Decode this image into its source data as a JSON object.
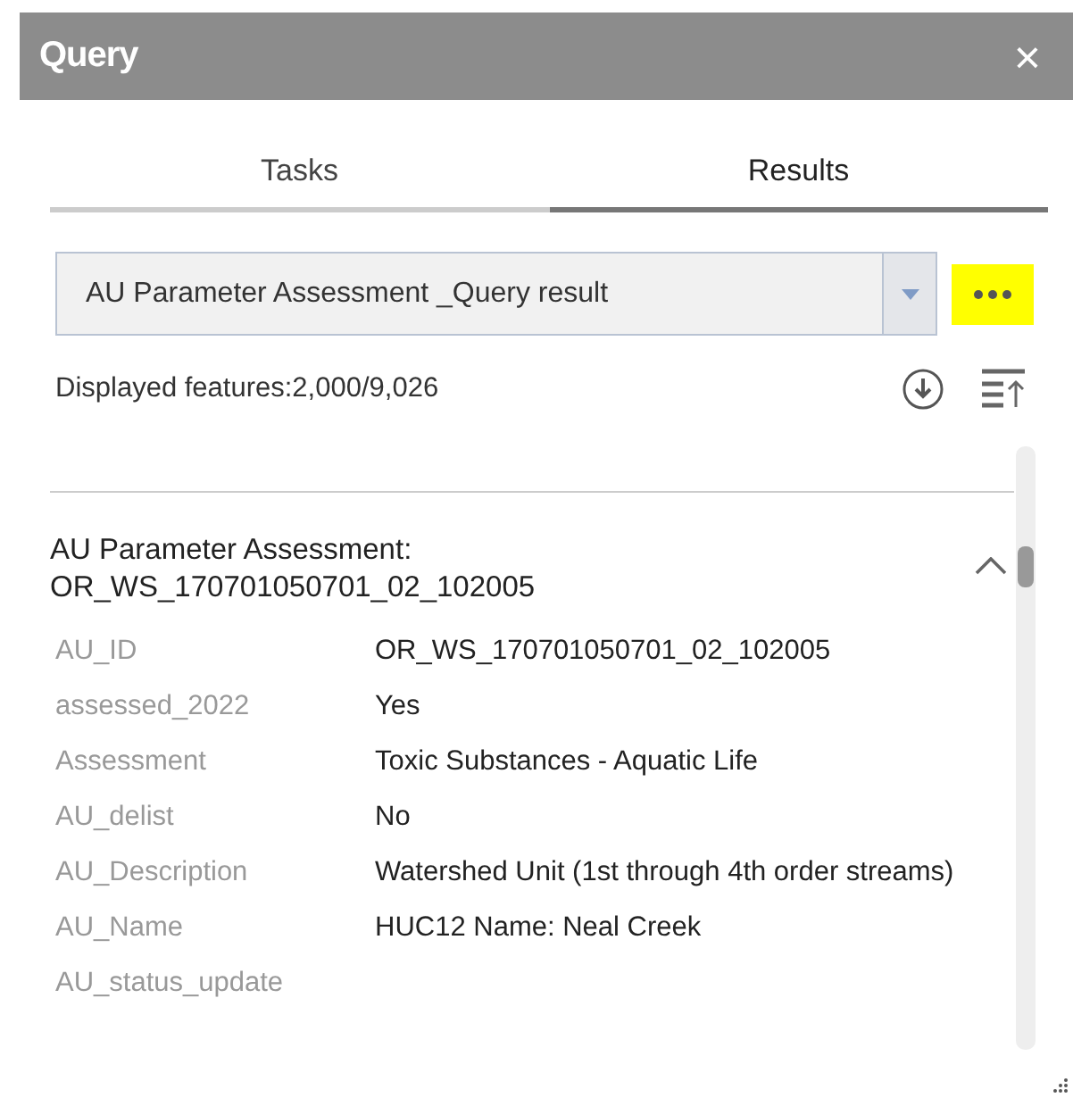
{
  "window": {
    "title": "Query",
    "close": "×"
  },
  "tabs": [
    {
      "label": "Tasks",
      "selected": false
    },
    {
      "label": "Results",
      "selected": true
    }
  ],
  "result_select": {
    "value": "AU Parameter Assessment _Query result",
    "more_highlighted": true
  },
  "summary": "Displayed features:2,000/9,026",
  "feature": {
    "title": "AU Parameter Assessment:",
    "subtitle": "OR_WS_170701050701_02_102005",
    "expanded": true,
    "fields": [
      {
        "label": "AU_ID",
        "value": "OR_WS_170701050701_02_102005"
      },
      {
        "label": "assessed_2022",
        "value": "Yes"
      },
      {
        "label": "Assessment",
        "value": "Toxic Substances - Aquatic Life"
      },
      {
        "label": "AU_delist",
        "value": "No"
      },
      {
        "label": "AU_Description",
        "value": "Watershed Unit (1st through 4th order streams)"
      },
      {
        "label": "AU_Name",
        "value": "HUC12 Name: Neal Creek"
      },
      {
        "label": "AU_status_update"
      }
    ]
  }
}
